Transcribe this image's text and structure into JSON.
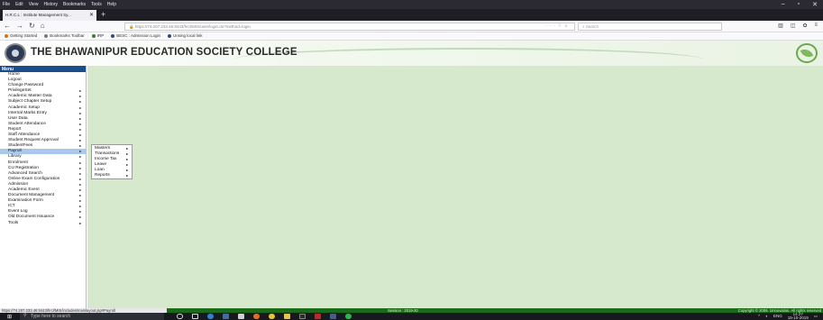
{
  "browser": {
    "menu": [
      "File",
      "Edit",
      "View",
      "History",
      "Bookmarks",
      "Tools",
      "Help"
    ],
    "tab_title": "H.R.C.L : Institute Management Sy...",
    "url_prefix": "https://",
    "url": "74.207.233.46:8443/hrcl/MIS/user/login.do?method=login",
    "search_placeholder": "Search",
    "bookmarks": [
      "Getting Started",
      "Bookmarks Toolbar",
      "IRP",
      "BESC : Admission Login",
      "Unsing local link"
    ]
  },
  "header": {
    "college_name": "THE BHAWANIPUR EDUCATION SOCIETY COLLEGE"
  },
  "sidebar": {
    "title": "Menu",
    "items": [
      {
        "label": "Home",
        "has_sub": false
      },
      {
        "label": "Logout",
        "has_sub": false
      },
      {
        "label": "Change Password",
        "has_sub": false
      },
      {
        "label": "PrivilegeSet",
        "has_sub": true
      },
      {
        "label": "Academic Master Data",
        "has_sub": true
      },
      {
        "label": "Subject Chapter Setup",
        "has_sub": true
      },
      {
        "label": "Academic Setup",
        "has_sub": true
      },
      {
        "label": "Internal Marks Entry",
        "has_sub": true
      },
      {
        "label": "User Data",
        "has_sub": true
      },
      {
        "label": "Student Attendance",
        "has_sub": true
      },
      {
        "label": "Report",
        "has_sub": true
      },
      {
        "label": "Staff Attendance",
        "has_sub": true
      },
      {
        "label": "Student Request Approval",
        "has_sub": true
      },
      {
        "label": "StudentFees",
        "has_sub": true
      },
      {
        "label": "Payroll",
        "has_sub": true,
        "active": true
      },
      {
        "label": "Library",
        "has_sub": true
      },
      {
        "label": "Enrolment",
        "has_sub": true
      },
      {
        "label": "CU Registration",
        "has_sub": true
      },
      {
        "label": "Advanced Search",
        "has_sub": true
      },
      {
        "label": "Online Exam Configuration",
        "has_sub": true
      },
      {
        "label": "Admission",
        "has_sub": true
      },
      {
        "label": "Academic Event",
        "has_sub": true
      },
      {
        "label": "Document Management",
        "has_sub": true
      },
      {
        "label": "Examination Form",
        "has_sub": true
      },
      {
        "label": "ICT",
        "has_sub": true
      },
      {
        "label": "Event Log",
        "has_sub": true
      },
      {
        "label": "Old Document Issuance",
        "has_sub": true
      },
      {
        "label": "Tools",
        "has_sub": true
      }
    ]
  },
  "submenu": {
    "items": [
      "Masters",
      "Transactions",
      "Income Tax",
      "Leave",
      "Loan",
      "Reports"
    ]
  },
  "status": {
    "link_url": "https://74.207.233.46:8443/hrcl/MIS/includes/mainlayout.jsp#Payroll",
    "session": "Session : 2019-20",
    "copyright": "Copyright © 2009. 1Innovation. All rights reserved"
  },
  "taskbar": {
    "search_placeholder": "Type here to search",
    "lang": "ENG",
    "time": "14:27",
    "date": "15-10-2019"
  },
  "colors": {
    "menu_header": "#1b4d8a",
    "content_bg": "#d6e9cc",
    "active_item": "#a8c8ec",
    "footer_bar": "#1a6a1a"
  }
}
